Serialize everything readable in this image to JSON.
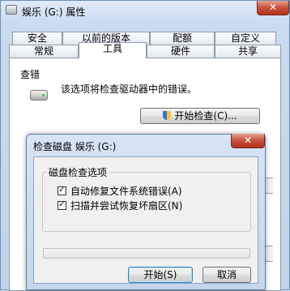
{
  "window": {
    "title": "娱乐 (G:) 属性",
    "close_glyph": "✕"
  },
  "tabs": {
    "row_top": [
      {
        "label": "安全"
      },
      {
        "label": "以前的版本"
      },
      {
        "label": "配额"
      },
      {
        "label": "自定义"
      }
    ],
    "row_bottom": [
      {
        "label": "常规"
      },
      {
        "label": "工具"
      },
      {
        "label": "硬件"
      },
      {
        "label": "共享"
      }
    ],
    "active": "工具"
  },
  "error_check": {
    "group_label": "查错",
    "description": "该选项将检查驱动器中的错误。",
    "button_label": "开始检查(C)...",
    "icon": "drive-icon"
  },
  "check_dialog": {
    "title": "检查磁盘 娱乐 (G:)",
    "close_glyph": "✕",
    "options_label": "磁盘检查选项",
    "options": [
      {
        "label": "自动修复文件系统错误(A)",
        "checked": true
      },
      {
        "label": "扫描并尝试恢复坏扇区(N)",
        "checked": true
      }
    ],
    "progress": 0,
    "start_label": "开始(S)",
    "cancel_label": "取消"
  }
}
